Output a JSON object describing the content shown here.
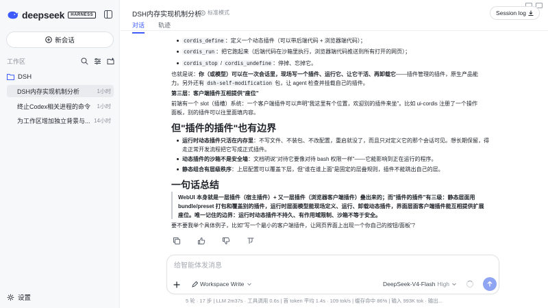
{
  "app": {
    "brand": "deepseek",
    "badge": "HARNESS"
  },
  "sidebar": {
    "new_chat": "新会话",
    "workspace_label": "工作区",
    "folder": "DSH",
    "sessions": [
      {
        "title": "DSH内存实现机制分析",
        "time": "1小时"
      },
      {
        "title": "终止Codex相关进程的命令",
        "time": "1小时"
      },
      {
        "title": "为工作区增加独立背景与...",
        "time": "14小时"
      }
    ],
    "settings": "设置"
  },
  "header": {
    "title": "DSH内存实现机制分析",
    "mode": "标准模式",
    "tabs": [
      "对话",
      "轨迹"
    ],
    "session_log": "Session log"
  },
  "content": {
    "c1a": "cordis_define",
    "c1b": "：定义一个动态插件（可以带后端代码 + 浏览器端代码）；",
    "c2a": "cordis_run",
    "c2b": "：把它跑起来（后端代码在沙箱里执行，浏览器端代码推送到所有打开的网页）；",
    "c3a": "cordis_stop",
    "c3sep": " / ",
    "c3b": "cordis_undefine",
    "c3c": "：停掉、忘掉它。",
    "p1a": "也就是说：",
    "p1b": "你（或模型）可以在一次会话里，现场写一个插件、运行它、让它干活、再卸载它",
    "p1c": "——插件管理的插件，原生产品能",
    "p1d": "力。另外还有 ",
    "p1code": "dsh-self-modification",
    "p1e": " 包，让 agent 检查并挂载自己的插件。",
    "h3": "第三层：客户端插件互相提供\"座位\"",
    "p2a": "前端有一个 slot（插槽）系统：一个客户端插件可以声明\"我这里有个位置，欢迎别的插件来坐\"。比如 ui-cordis 注册了一个操作",
    "p2b": "面板，别的插件可以往里面填内容。",
    "h2a": "但\"插件的插件\"也有边界",
    "b1a": "运行时动态插件只活在内存里",
    "b1b": "：不写文件、不装包、不改配置，重启就没了，而且只对定义它的那个会话可见。想长期保留，得",
    "b1c": "走正常开发流程把它写成正式插件。",
    "b2a": "动态插件的沙箱不是安全墙",
    "b2b": "：文档明说\"对待它要像对待 bash 权限一样\"——它能影响到正在运行的程序。",
    "b3a": "静态组合有层级秩序",
    "b3b": "：上层配置可以覆盖下层，但\"谁在谁上面\"是固定的层叠规则，插件不能跳出自己的层。",
    "h2b": "一句话总结",
    "q1": "WebUI 本身就是一层插件（宿主插件）+ 又一层插件（浏览器客户端插件）叠出来的；而\"插件的插件\"有三级：静态层面用",
    "q2": "bundle/preset 打包和覆盖别的插件，运行时层面模型能现场定义、运行、卸载动态插件，界面层面客户端插件能互相提供扩展",
    "q3": "座位。唯一记住的边界：运行时动态插件不持久、有作用域限制、沙箱不等于安全。",
    "p3": "要不要我举个具体例子，比如\"写一个最小的客户端插件，让网页界面上出现一个你自己的按钮/面板\"？"
  },
  "composer": {
    "placeholder": "给智能体发消息",
    "workspace_write": "Workspace Write",
    "model": "DeepSeek-V4-Flash",
    "level": "High"
  },
  "statusbar": "5 轮 · 17 步  |  LLM 2m37s · 工具调用 0.6s  |  首 token 平均 1.4s · 109 tok/s  |  缓存命中 86%  |  输入 993K tok · 输出..."
}
